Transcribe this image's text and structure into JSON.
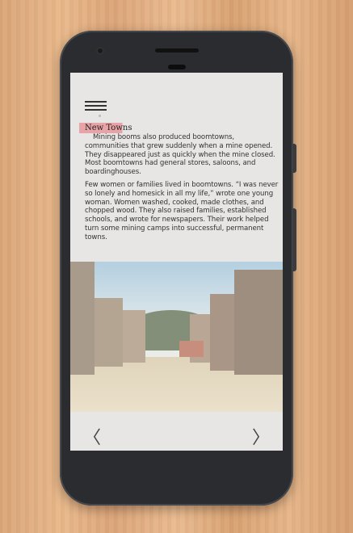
{
  "section_title": "New Towns",
  "paragraphs": [
    "Mining booms also produced boomtowns, communities that grew suddenly when a mine opened. They disappeared just as quickly when the mine closed. Most boomtowns had general stores, saloons, and boardinghouses.",
    "Few women or families lived in boomtowns. “I was never so lonely and homesick in all my life,” wrote one young woman. Women washed, cooked, made clothes, and chopped wood. They also raised families, established schools, and wrote for newspapers. Their work helped turn some mining camps into successful, permanent towns."
  ],
  "nav": {
    "prev": "〈",
    "next": "〉"
  },
  "icons": {
    "menu": "hamburger-menu-icon"
  },
  "colors": {
    "highlight": "#e7a3a6"
  }
}
